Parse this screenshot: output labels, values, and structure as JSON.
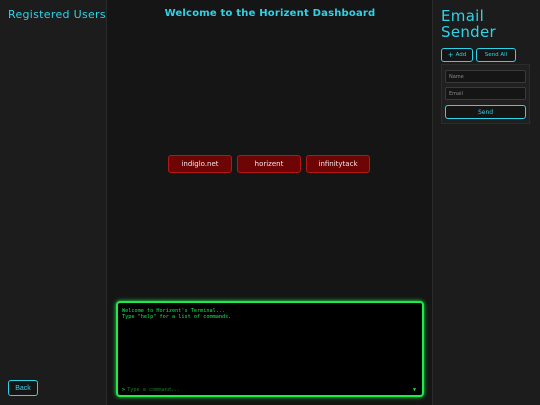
{
  "left_panel": {
    "title": "Registered Users",
    "back_label": "Back"
  },
  "main": {
    "title": "Welcome to the Horizent Dashboard",
    "domains": [
      "indiglo.net",
      "horizent",
      "infinitytack"
    ]
  },
  "terminal": {
    "lines": [
      "Welcome to Horizent's Terminal...",
      "Type \"help\" for a list of commands."
    ],
    "prompt": ">",
    "input_placeholder": "Type a command..."
  },
  "right_panel": {
    "title": "Email Sender",
    "add_label": "Add",
    "send_all_label": "Send All",
    "name_placeholder": "Name",
    "email_placeholder": "Email",
    "send_label": "Send"
  },
  "colors": {
    "accent": "#2fd3e8",
    "terminal_green": "#1eea4a",
    "domain_red": "#6e0505",
    "background": "#151515"
  }
}
